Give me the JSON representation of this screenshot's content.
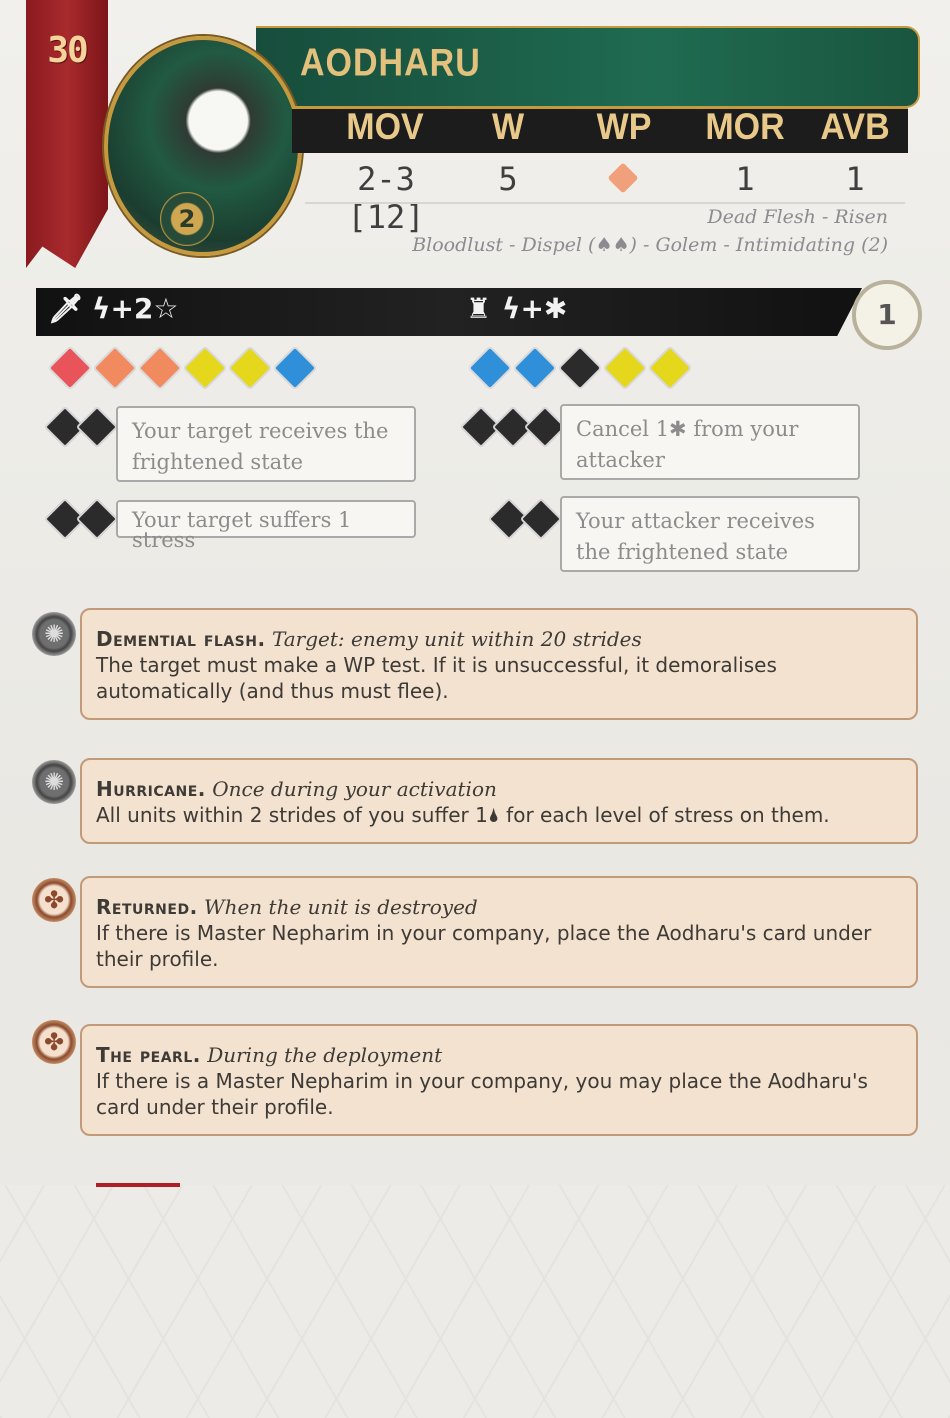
{
  "unit": {
    "cost": "30",
    "name": "AODHARU",
    "rank_badge": "2"
  },
  "stats": {
    "labels": [
      "MOV",
      "W",
      "WP",
      "MOR",
      "AVB"
    ],
    "values": [
      "2-3 [12]",
      "5",
      "",
      "1",
      "1"
    ],
    "wp_color": "#f0a07a"
  },
  "keywords": {
    "line1": "Dead Flesh - Risen",
    "line2": "Bloodlust - Dispel (♠♠) - Golem - Intimidating (2)"
  },
  "attack": {
    "melee_label": "ϟ+2☆",
    "defense_label": "ϟ+✱",
    "counter_badge": "1",
    "melee_dice": [
      "#e8545a",
      "#f28a60",
      "#f28a60",
      "#e5d71c",
      "#e5d71c",
      "#2f8fd8"
    ],
    "defense_dice": [
      "#2f8fd8",
      "#2f8fd8",
      "#2b2b2b",
      "#e5d71c",
      "#e5d71c"
    ]
  },
  "effects": {
    "melee_1": "Your target receives the frightened state",
    "melee_2": "Your target suffers 1 stress",
    "defense_1": "Cancel 1✱ from your attacker",
    "defense_2": "Your attacker receives the frightened state"
  },
  "abilities": [
    {
      "name": "Demential flash.",
      "trigger": "Target: enemy unit within 20 strides",
      "text": "The target must make a WP test. If it is unsuccessful, it demoralises automatically (and thus must flee).",
      "icon": "gear-icon"
    },
    {
      "name": "Hurricane.",
      "trigger": "Once during your activation",
      "text": "All units within 2 strides of you suffer 1🌢 for each level of stress on them.",
      "icon": "gear-icon"
    },
    {
      "name": "Returned.",
      "trigger": "When the unit is destroyed",
      "text": "If there is Master Nepharim in your company, place the Aodharu's card under their profile.",
      "icon": "trefoil-icon"
    },
    {
      "name": "The pearl.",
      "trigger": "During the deployment",
      "text": "If there is a Master Nepharim in your company, you may place the Aodharu's card under their profile.",
      "icon": "trefoil-icon"
    }
  ]
}
